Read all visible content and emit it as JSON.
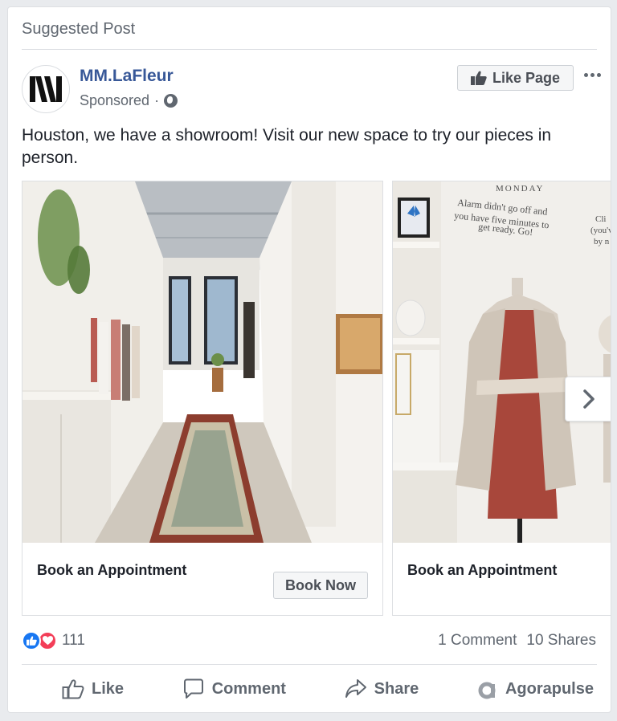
{
  "header": {
    "suggested_label": "Suggested Post"
  },
  "page": {
    "name": "MM.LaFleur",
    "sponsored_label": "Sponsored",
    "separator": "·"
  },
  "buttons": {
    "like_page": "Like Page"
  },
  "post": {
    "text": "Houston, we have a showroom! Visit our new space to try our pieces in person."
  },
  "carousel": {
    "cards": [
      {
        "title": "Book an Appointment",
        "cta": "Book Now"
      },
      {
        "title": "Book an Appointment"
      }
    ],
    "wall_text": [
      "MONDAY",
      "Alarm didn't go off and",
      "you have five minutes to",
      "get ready. Go!"
    ],
    "wall_text_right": [
      "Cli",
      "(you've",
      "by n"
    ]
  },
  "engagement": {
    "reaction_count": "111",
    "comments": "1 Comment",
    "shares": "10 Shares"
  },
  "actions": {
    "like": "Like",
    "comment": "Comment",
    "share": "Share",
    "agorapulse": "Agorapulse"
  },
  "colors": {
    "link": "#385898",
    "like": "#1877f2",
    "love": "#f33e58",
    "muted": "#606770"
  },
  "icons": [
    "globe-icon",
    "thumbs-up-icon",
    "more-icon",
    "chevron-right-icon",
    "like-reaction-icon",
    "love-reaction-icon",
    "comment-icon",
    "share-icon",
    "agorapulse-icon"
  ]
}
